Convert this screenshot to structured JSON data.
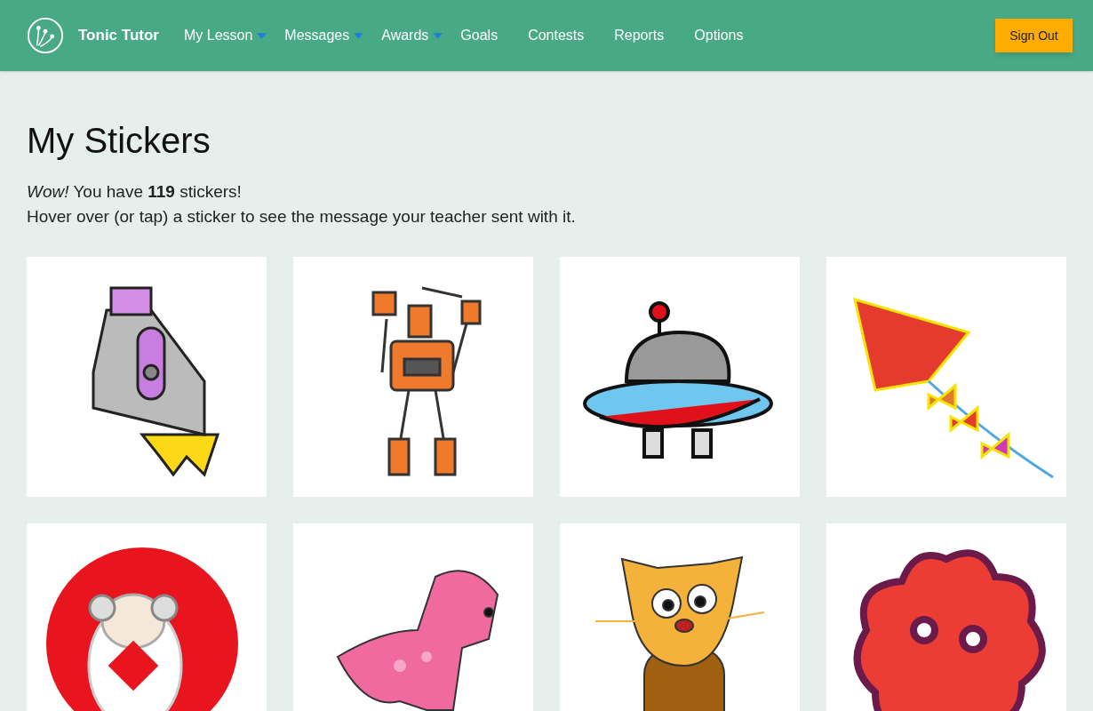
{
  "header": {
    "brand": "Tonic Tutor",
    "nav": [
      {
        "label": "My Lesson",
        "has_menu": true
      },
      {
        "label": "Messages",
        "has_menu": true
      },
      {
        "label": "Awards",
        "has_menu": true
      },
      {
        "label": "Goals",
        "has_menu": false
      },
      {
        "label": "Contests",
        "has_menu": false
      },
      {
        "label": "Reports",
        "has_menu": false
      },
      {
        "label": "Options",
        "has_menu": false
      }
    ],
    "sign_out": "Sign Out"
  },
  "page": {
    "title": "My Stickers",
    "summary": "*Wow!* You have **119** stickers!",
    "hint": "Hover over (or tap) a sticker to see the message your teacher sent with it."
  },
  "stickers": [
    {
      "kind": "rocket"
    },
    {
      "kind": "robot"
    },
    {
      "kind": "ufo"
    },
    {
      "kind": "kite"
    },
    {
      "kind": "sheep"
    },
    {
      "kind": "dinosaur"
    },
    {
      "kind": "cat"
    },
    {
      "kind": "flower"
    }
  ]
}
